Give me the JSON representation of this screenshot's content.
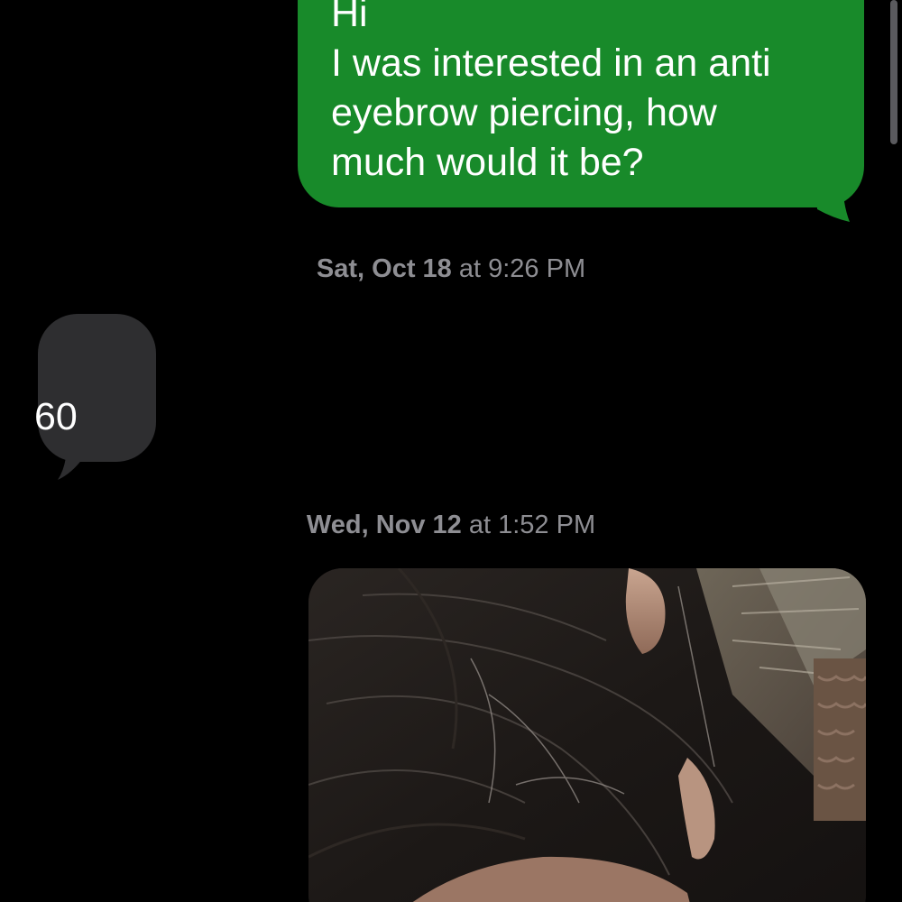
{
  "conversation": {
    "outgoing_message": {
      "lines": [
        "Hi",
        "I was interested in an anti",
        "eyebrow piercing, how",
        "much would it be?"
      ],
      "bubble_color": "#188a2a"
    },
    "timestamps": [
      {
        "day": "Sat, Oct 18",
        "at": " at ",
        "time": "9:26 PM"
      },
      {
        "day": "Wed, Nov 12",
        "at": " at ",
        "time": "1:52 PM"
      }
    ],
    "incoming_message": {
      "text": "60",
      "bubble_color": "#2e2e30"
    },
    "photo_attachment": {
      "icon": "photo-attachment"
    }
  }
}
